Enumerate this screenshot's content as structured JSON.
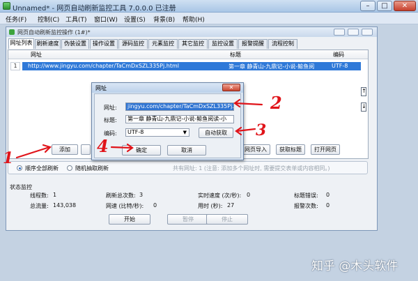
{
  "app": {
    "title": "Unnamed* - 网页自动刷新监控工具 7.0.0.0 已注册",
    "menu": [
      "任务(F)",
      "控制(C)",
      "工具(T)",
      "窗口(W)",
      "设置(S)",
      "背景(B)",
      "帮助(H)"
    ]
  },
  "child_window": {
    "title": "网页自动刷新监控操作 (1#)*",
    "tabs": [
      "网址列表",
      "刷新速度",
      "伪装设置",
      "操作设置",
      "源码监控",
      "元素监控",
      "其它监控",
      "监控设置",
      "报警提醒",
      "流程控制"
    ],
    "table": {
      "headers": [
        "网址",
        "标题",
        "编码"
      ],
      "rows": [
        {
          "num": "1",
          "url": "http://www.jingyu.com/chapter/TaCmDxSZL335Pj.html",
          "title": "第一章 静青山-九鼎记-小说-鲸鱼阅",
          "encoding": "UTF-8"
        }
      ]
    },
    "buttons": {
      "add": "添加",
      "import": "网页导入",
      "get_title": "获取标题",
      "open_page": "打开网页"
    },
    "refresh": {
      "sequential": "顺序全部刷新",
      "random": "随机抽取刷新",
      "note": "共有网址: 1 (注意: 添加多个网址时, 需要提交表单或内容相同。)"
    },
    "status": {
      "heading": "状态监控",
      "threads_label": "线程数:",
      "threads": "1",
      "refresh_total_label": "刷新总次数:",
      "refresh_total": "3",
      "realtime_speed_label": "实时速度 (次/秒):",
      "realtime_speed": "0",
      "title_error_label": "标题错误:",
      "title_error": "0",
      "traffic_label": "总流量:",
      "traffic": "143,038",
      "net_speed_label": "网速 (比特/秒):",
      "net_speed": "0",
      "elapsed_label": "用时 (秒):",
      "elapsed": "27",
      "alarm_label": "报警次数:",
      "alarm": "0"
    },
    "controls": {
      "start": "开始",
      "pause": "暂停",
      "stop": "停止"
    }
  },
  "dialog": {
    "title": "网址",
    "url_label": "网址:",
    "url_value": "jingyu.com/chapter/TaCmDxSZL335Pj.html",
    "title_label": "标题:",
    "title_value": "第一章 静青山-九鼎记-小说-鲸鱼阅读-小",
    "encoding_label": "编码:",
    "encoding_value": "UTF-8",
    "auto_get": "自动获取",
    "ok": "确定",
    "cancel": "取消"
  },
  "annotations": [
    "1",
    "2",
    "3",
    "4"
  ],
  "watermark": "知乎 @木头软件",
  "colors": {
    "selection": "#2f79d8",
    "annotation": "#e0141a"
  }
}
